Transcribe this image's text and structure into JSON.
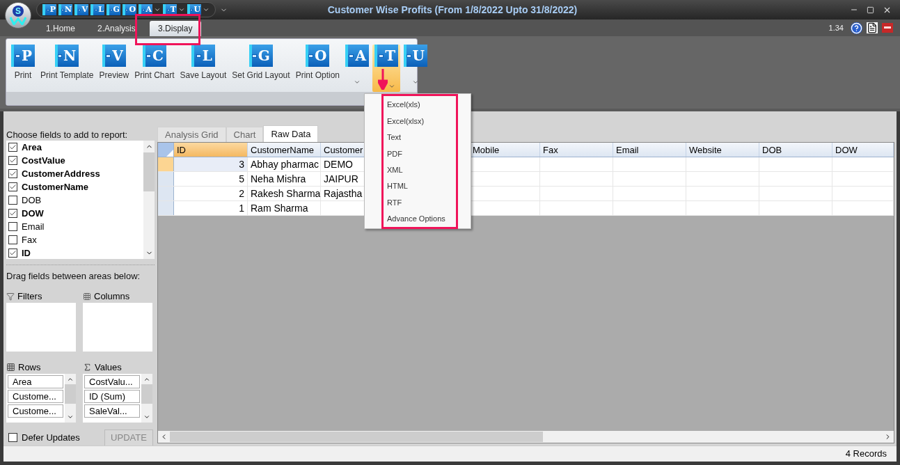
{
  "window": {
    "title": "Customer Wise Profits (From 1/8/2022 Upto 31/8/2022)",
    "version": "1.34",
    "logo": "S"
  },
  "quick_access": [
    {
      "letter": "P",
      "dropdown": false
    },
    {
      "letter": "N",
      "dropdown": false
    },
    {
      "letter": "V",
      "dropdown": false
    },
    {
      "letter": "L",
      "dropdown": false
    },
    {
      "letter": "G",
      "dropdown": false
    },
    {
      "letter": "O",
      "dropdown": false
    },
    {
      "letter": "A",
      "dropdown": true
    },
    {
      "letter": "T",
      "dropdown": true
    },
    {
      "letter": "U",
      "dropdown": true
    }
  ],
  "tabs": [
    {
      "label": "1.Home",
      "selected": false
    },
    {
      "label": "2.Analysis",
      "selected": false
    },
    {
      "label": "3.Display",
      "selected": true
    }
  ],
  "ribbon": {
    "buttons": [
      {
        "letter": "P",
        "label": "Print",
        "dropdown": false,
        "highlighted": false
      },
      {
        "letter": "N",
        "label": "Print Template",
        "dropdown": false,
        "highlighted": false
      },
      {
        "letter": "V",
        "label": "Preview",
        "dropdown": false,
        "highlighted": false
      },
      {
        "letter": "C",
        "label": "Print Chart",
        "dropdown": false,
        "highlighted": false
      },
      {
        "letter": "L",
        "label": "Save Layout",
        "dropdown": false,
        "highlighted": false
      },
      {
        "letter": "G",
        "label": "Set Grid Layout",
        "dropdown": false,
        "highlighted": false
      },
      {
        "letter": "O",
        "label": "Print Option",
        "dropdown": false,
        "highlighted": false
      },
      {
        "letter": "A",
        "dropdown": true,
        "highlighted": false
      },
      {
        "letter": "T",
        "dropdown": true,
        "highlighted": true
      },
      {
        "letter": "U",
        "dropdown": true,
        "highlighted": false
      }
    ]
  },
  "export_menu": {
    "items": [
      "Excel(xls)",
      "Excel(xlsx)",
      "Text",
      "PDF",
      "XML",
      "HTML",
      "RTF",
      "Advance Options"
    ]
  },
  "field_list": {
    "title": "Choose fields to add to report:",
    "fields": [
      {
        "label": "Area",
        "checked": true
      },
      {
        "label": "CostValue",
        "checked": true
      },
      {
        "label": "CustomerAddress",
        "checked": true
      },
      {
        "label": "CustomerName",
        "checked": true
      },
      {
        "label": "DOB",
        "checked": false
      },
      {
        "label": "DOW",
        "checked": true
      },
      {
        "label": "Email",
        "checked": false
      },
      {
        "label": "Fax",
        "checked": false
      },
      {
        "label": "ID",
        "checked": true
      }
    ]
  },
  "areas": {
    "title": "Drag fields between areas below:",
    "filters": {
      "label": "Filters"
    },
    "columns": {
      "label": "Columns"
    },
    "rows": {
      "label": "Rows",
      "items": [
        "Area",
        "Custome...",
        "Custome..."
      ]
    },
    "values": {
      "label": "Values",
      "items": [
        "CostValu...",
        "ID (Sum)",
        "SaleVal..."
      ]
    }
  },
  "defer_updates": {
    "label": "Defer Updates",
    "checked": false
  },
  "update_button": {
    "label": "UPDATE",
    "disabled": true
  },
  "view_tabs": [
    {
      "label": "Analysis Grid",
      "selected": false
    },
    {
      "label": "Chart",
      "selected": false
    },
    {
      "label": "Raw Data",
      "selected": true
    }
  ],
  "grid": {
    "columns": [
      "ID",
      "CustomerName",
      "Customer",
      "Mobile",
      "Fax",
      "Email",
      "Website",
      "DOB",
      "DOW"
    ],
    "rows": [
      {
        "selected": true,
        "cells": [
          "3",
          "Abhay pharmac",
          "DEMO"
        ]
      },
      {
        "selected": false,
        "cells": [
          "5",
          "Neha Mishra",
          "JAIPUR"
        ]
      },
      {
        "selected": false,
        "cells": [
          "2",
          "Rakesh Sharma",
          "Rajastha"
        ]
      },
      {
        "selected": false,
        "cells": [
          "1",
          "Ram Sharma"
        ]
      }
    ]
  },
  "status_bar": {
    "text": "4 Records"
  }
}
